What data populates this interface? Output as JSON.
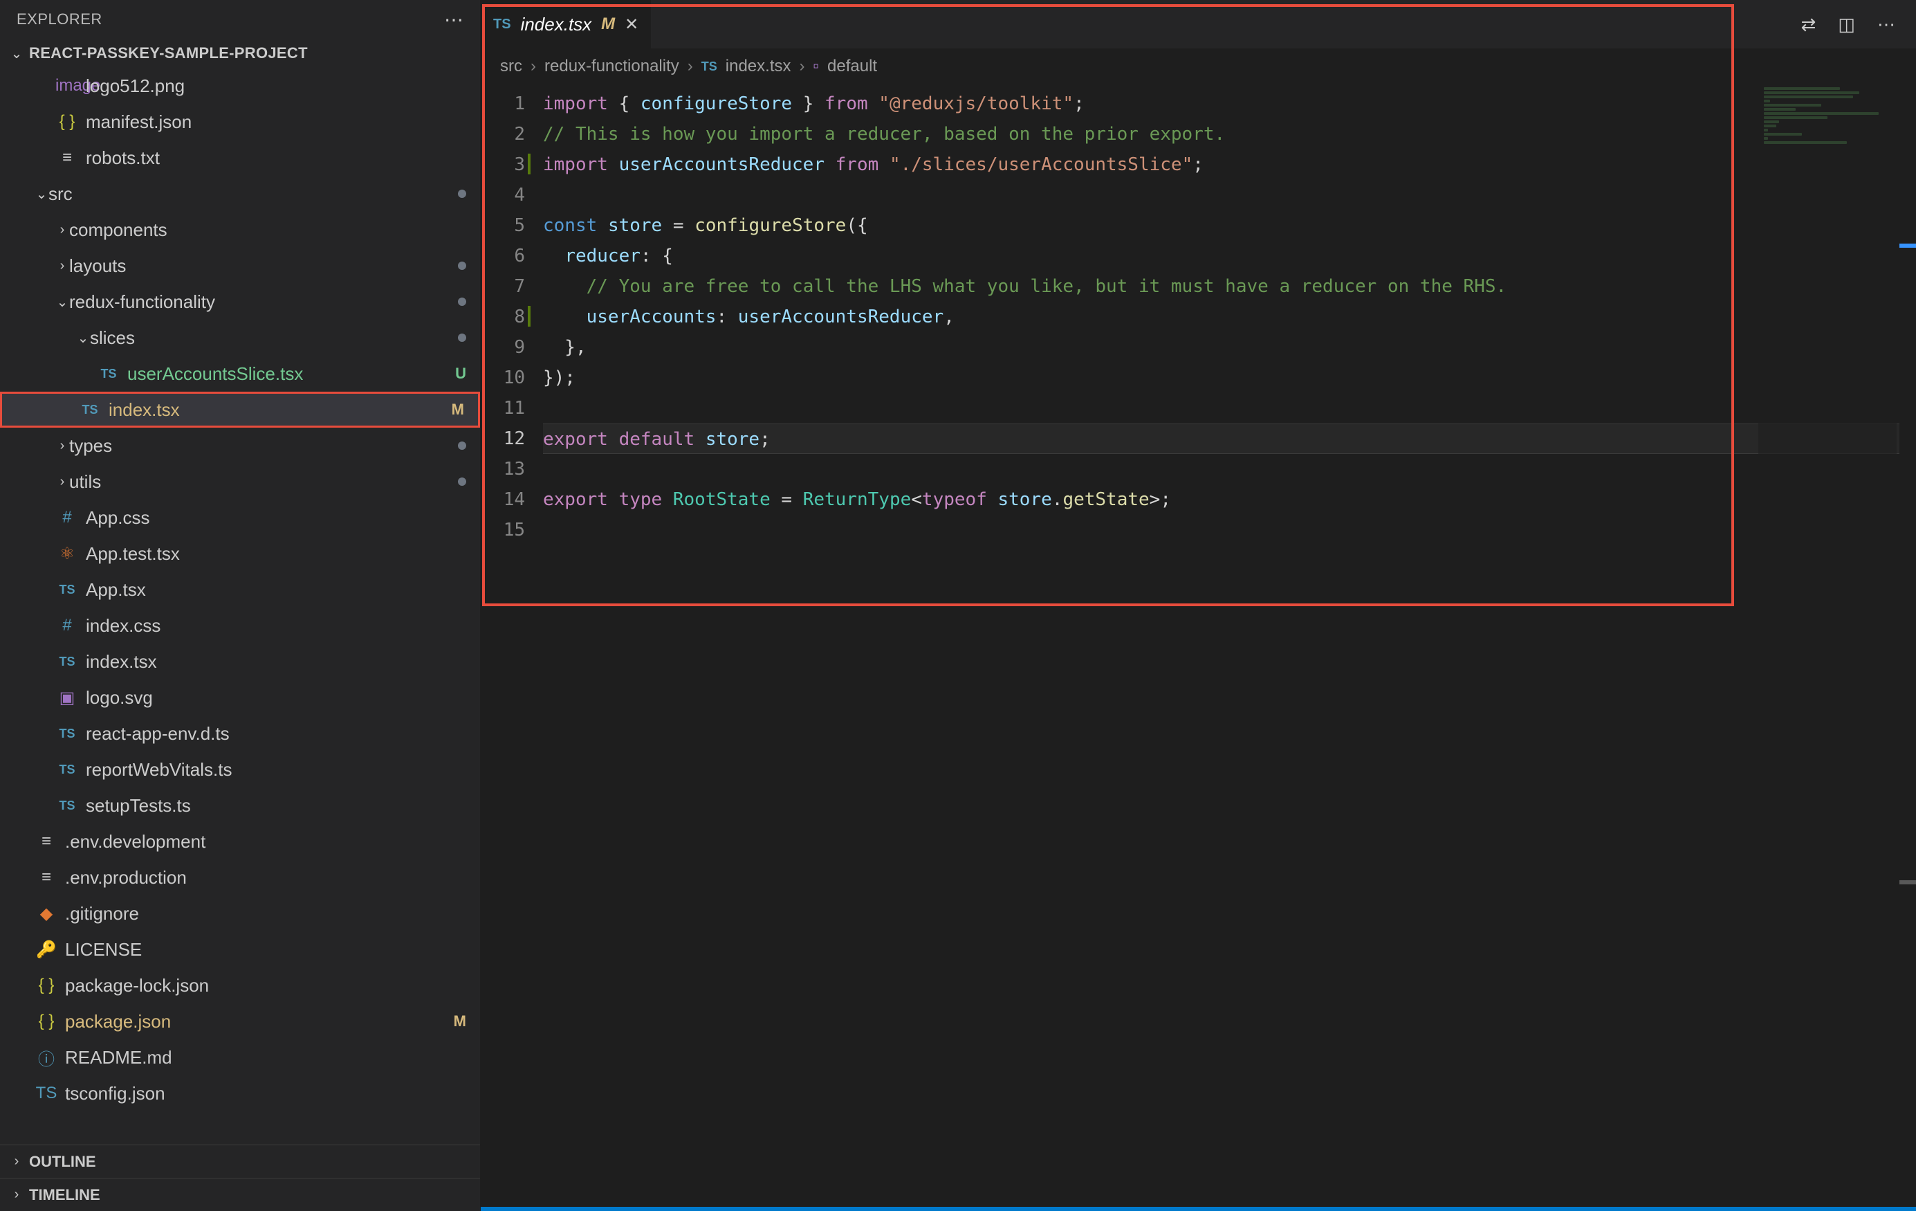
{
  "explorer": {
    "title": "EXPLORER",
    "project_name": "REACT-PASSKEY-SAMPLE-PROJECT"
  },
  "tree": [
    {
      "depth": 2,
      "icon": "image",
      "iconClass": "ico-svg",
      "label": "logo512.png",
      "badge": "",
      "dot": false
    },
    {
      "depth": 2,
      "icon": "{ }",
      "iconClass": "ico-json",
      "label": "manifest.json",
      "badge": "",
      "dot": false
    },
    {
      "depth": 2,
      "icon": "≡",
      "iconClass": "ico-txt",
      "label": "robots.txt",
      "badge": "",
      "dot": false
    },
    {
      "depth": 1,
      "chevron": "down",
      "label": "src",
      "badge": "",
      "dot": true
    },
    {
      "depth": 2,
      "chevron": "right",
      "label": "components",
      "badge": "",
      "dot": false
    },
    {
      "depth": 2,
      "chevron": "right",
      "label": "layouts",
      "badge": "",
      "dot": true
    },
    {
      "depth": 2,
      "chevron": "down",
      "label": "redux-functionality",
      "badge": "",
      "dot": true
    },
    {
      "depth": 3,
      "chevron": "down",
      "label": "slices",
      "badge": "",
      "dot": true
    },
    {
      "depth": 4,
      "icon": "TS",
      "iconClass": "ico-ts",
      "label": "userAccountsSlice.tsx",
      "badge": "U",
      "dot": false
    },
    {
      "depth": 3,
      "icon": "TS",
      "iconClass": "ico-ts",
      "label": "index.tsx",
      "badge": "M",
      "dot": false,
      "selected": true
    },
    {
      "depth": 2,
      "chevron": "right",
      "label": "types",
      "badge": "",
      "dot": true
    },
    {
      "depth": 2,
      "chevron": "right",
      "label": "utils",
      "badge": "",
      "dot": true
    },
    {
      "depth": 2,
      "icon": "#",
      "iconClass": "ico-css",
      "label": "App.css",
      "badge": "",
      "dot": false
    },
    {
      "depth": 2,
      "icon": "⚛",
      "iconClass": "ico-react",
      "label": "App.test.tsx",
      "badge": "",
      "dot": false
    },
    {
      "depth": 2,
      "icon": "TS",
      "iconClass": "ico-ts",
      "label": "App.tsx",
      "badge": "",
      "dot": false
    },
    {
      "depth": 2,
      "icon": "#",
      "iconClass": "ico-css",
      "label": "index.css",
      "badge": "",
      "dot": false
    },
    {
      "depth": 2,
      "icon": "TS",
      "iconClass": "ico-ts",
      "label": "index.tsx",
      "badge": "",
      "dot": false
    },
    {
      "depth": 2,
      "icon": "▣",
      "iconClass": "ico-svg",
      "label": "logo.svg",
      "badge": "",
      "dot": false
    },
    {
      "depth": 2,
      "icon": "TS",
      "iconClass": "ico-ts",
      "label": "react-app-env.d.ts",
      "badge": "",
      "dot": false
    },
    {
      "depth": 2,
      "icon": "TS",
      "iconClass": "ico-ts",
      "label": "reportWebVitals.ts",
      "badge": "",
      "dot": false
    },
    {
      "depth": 2,
      "icon": "TS",
      "iconClass": "ico-ts",
      "label": "setupTests.ts",
      "badge": "",
      "dot": false
    },
    {
      "depth": 1,
      "icon": "≡",
      "iconClass": "ico-txt",
      "label": ".env.development",
      "badge": "",
      "dot": false
    },
    {
      "depth": 1,
      "icon": "≡",
      "iconClass": "ico-txt",
      "label": ".env.production",
      "badge": "",
      "dot": false
    },
    {
      "depth": 1,
      "icon": "◆",
      "iconClass": "ico-git",
      "label": ".gitignore",
      "badge": "",
      "dot": false
    },
    {
      "depth": 1,
      "icon": "🔑",
      "iconClass": "ico-license",
      "label": "LICENSE",
      "badge": "",
      "dot": false
    },
    {
      "depth": 1,
      "icon": "{ }",
      "iconClass": "ico-json",
      "label": "package-lock.json",
      "badge": "",
      "dot": false
    },
    {
      "depth": 1,
      "icon": "{ }",
      "iconClass": "ico-json",
      "label": "package.json",
      "badge": "M",
      "dot": false
    },
    {
      "depth": 1,
      "icon": "ⓘ",
      "iconClass": "ico-info",
      "label": "README.md",
      "badge": "",
      "dot": false
    },
    {
      "depth": 1,
      "icon": "TS",
      "iconClass": "ico-tsconfig",
      "label": "tsconfig.json",
      "badge": "",
      "dot": false
    }
  ],
  "sections": {
    "outline": "OUTLINE",
    "timeline": "TIMELINE"
  },
  "tab": {
    "icon": "TS",
    "label": "index.tsx",
    "modified": "M"
  },
  "breadcrumb": {
    "parts": [
      "src",
      "redux-functionality"
    ],
    "file_icon": "TS",
    "file": "index.tsx",
    "symbol": "default"
  },
  "code": {
    "active_line": 12,
    "lines": [
      {
        "n": 1,
        "deco": false,
        "tokens": [
          [
            "tk-key",
            "import"
          ],
          [
            "tk-punc",
            " { "
          ],
          [
            "tk-var",
            "configureStore"
          ],
          [
            "tk-punc",
            " } "
          ],
          [
            "tk-key",
            "from"
          ],
          [
            "tk-punc",
            " "
          ],
          [
            "tk-str",
            "\"@reduxjs/toolkit\""
          ],
          [
            "tk-punc",
            ";"
          ]
        ]
      },
      {
        "n": 2,
        "deco": false,
        "tokens": [
          [
            "tk-com",
            "// This is how you import a reducer, based on the prior export."
          ]
        ]
      },
      {
        "n": 3,
        "deco": true,
        "tokens": [
          [
            "tk-key",
            "import"
          ],
          [
            "tk-punc",
            " "
          ],
          [
            "tk-var",
            "userAccountsReducer"
          ],
          [
            "tk-punc",
            " "
          ],
          [
            "tk-key",
            "from"
          ],
          [
            "tk-punc",
            " "
          ],
          [
            "tk-str",
            "\"./slices/userAccountsSlice\""
          ],
          [
            "tk-punc",
            ";"
          ]
        ]
      },
      {
        "n": 4,
        "deco": false,
        "tokens": [
          [
            "tk-punc",
            ""
          ]
        ]
      },
      {
        "n": 5,
        "deco": false,
        "tokens": [
          [
            "tk-const",
            "const"
          ],
          [
            "tk-punc",
            " "
          ],
          [
            "tk-var",
            "store"
          ],
          [
            "tk-punc",
            " = "
          ],
          [
            "tk-fn",
            "configureStore"
          ],
          [
            "tk-punc",
            "({"
          ]
        ]
      },
      {
        "n": 6,
        "deco": false,
        "tokens": [
          [
            "tk-punc",
            "  "
          ],
          [
            "tk-var",
            "reducer"
          ],
          [
            "tk-punc",
            ": {"
          ]
        ]
      },
      {
        "n": 7,
        "deco": false,
        "tokens": [
          [
            "tk-punc",
            "    "
          ],
          [
            "tk-com",
            "// You are free to call the LHS what you like, but it must have a reducer on the RHS."
          ]
        ]
      },
      {
        "n": 8,
        "deco": true,
        "tokens": [
          [
            "tk-punc",
            "    "
          ],
          [
            "tk-var",
            "userAccounts"
          ],
          [
            "tk-punc",
            ": "
          ],
          [
            "tk-var",
            "userAccountsReducer"
          ],
          [
            "tk-punc",
            ","
          ]
        ]
      },
      {
        "n": 9,
        "deco": false,
        "tokens": [
          [
            "tk-punc",
            "  },"
          ]
        ]
      },
      {
        "n": 10,
        "deco": false,
        "tokens": [
          [
            "tk-punc",
            "});"
          ]
        ]
      },
      {
        "n": 11,
        "deco": false,
        "tokens": [
          [
            "tk-punc",
            ""
          ]
        ]
      },
      {
        "n": 12,
        "deco": false,
        "tokens": [
          [
            "tk-key",
            "export"
          ],
          [
            "tk-punc",
            " "
          ],
          [
            "tk-key",
            "default"
          ],
          [
            "tk-punc",
            " "
          ],
          [
            "tk-var",
            "store"
          ],
          [
            "tk-punc",
            ";"
          ]
        ]
      },
      {
        "n": 13,
        "deco": false,
        "tokens": [
          [
            "tk-punc",
            ""
          ]
        ]
      },
      {
        "n": 14,
        "deco": false,
        "tokens": [
          [
            "tk-key",
            "export"
          ],
          [
            "tk-punc",
            " "
          ],
          [
            "tk-key",
            "type"
          ],
          [
            "tk-punc",
            " "
          ],
          [
            "tk-type",
            "RootState"
          ],
          [
            "tk-punc",
            " = "
          ],
          [
            "tk-type",
            "ReturnType"
          ],
          [
            "tk-punc",
            "<"
          ],
          [
            "tk-key",
            "typeof"
          ],
          [
            "tk-punc",
            " "
          ],
          [
            "tk-var",
            "store"
          ],
          [
            "tk-punc",
            "."
          ],
          [
            "tk-fn",
            "getState"
          ],
          [
            "tk-punc",
            ">;"
          ]
        ]
      },
      {
        "n": 15,
        "deco": false,
        "tokens": [
          [
            "tk-punc",
            ""
          ]
        ]
      }
    ]
  }
}
